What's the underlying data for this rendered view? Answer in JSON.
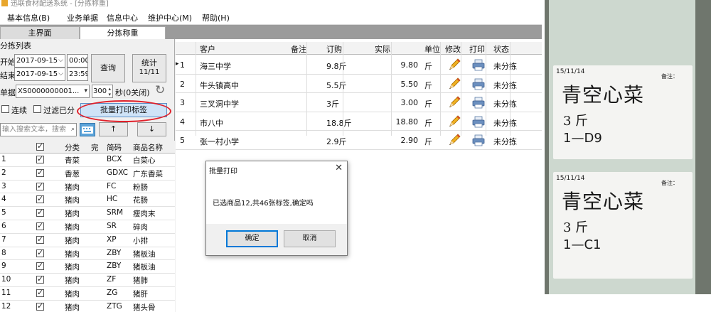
{
  "app": {
    "title": "迅联食材配送系统 - [分拣称重]",
    "menu": [
      "基本信息(B)",
      "业务单据",
      "信息中心",
      "维护中心(M)",
      "帮助(H)"
    ],
    "tabs": [
      "主界面",
      "分拣称重"
    ]
  },
  "left": {
    "section_title": "分拣列表",
    "start_label": "开始",
    "end_label": "结束",
    "start_date": "2017-09-15",
    "start_time": "00:00",
    "end_date": "2017-09-15",
    "end_time": "23:59",
    "query_button": "查询",
    "stats_button_line1": "统计",
    "stats_button_line2": "11/11",
    "doc_label": "单据",
    "doc_value": "XS0000000001...",
    "interval_value": "300",
    "interval_unit": "秒(0关闭)",
    "continuous_label": "连续",
    "filter_label": "过滤已分",
    "batch_print_button": "批量打印标签",
    "search_placeholder": "输入搜索文本，搜索",
    "up_arrow": "↑",
    "down_arrow": "↓",
    "columns": [
      "分类",
      "完",
      "简码",
      "商品名称"
    ],
    "rows": [
      {
        "num": "1",
        "category": "青菜",
        "code": "BCX",
        "name": "白菜心"
      },
      {
        "num": "2",
        "category": "香葱",
        "code": "GDXC",
        "name": "广东香菜"
      },
      {
        "num": "3",
        "category": "猪肉",
        "code": "FC",
        "name": "粉肠"
      },
      {
        "num": "4",
        "category": "猪肉",
        "code": "HC",
        "name": "花肠"
      },
      {
        "num": "5",
        "category": "猪肉",
        "code": "SRM",
        "name": "瘦肉末"
      },
      {
        "num": "6",
        "category": "猪肉",
        "code": "SR",
        "name": "碎肉"
      },
      {
        "num": "7",
        "category": "猪肉",
        "code": "XP",
        "name": "小排"
      },
      {
        "num": "8",
        "category": "猪肉",
        "code": "ZBY",
        "name": "猪板油"
      },
      {
        "num": "9",
        "category": "猪肉",
        "code": "ZBY",
        "name": "猪板油"
      },
      {
        "num": "10",
        "category": "猪肉",
        "code": "ZF",
        "name": "猪肺"
      },
      {
        "num": "11",
        "category": "猪肉",
        "code": "ZG",
        "name": "猪肝"
      },
      {
        "num": "12",
        "category": "猪肉",
        "code": "ZTG",
        "name": "猪头骨"
      }
    ]
  },
  "orders": {
    "columns": [
      "客户",
      "备注",
      "订购",
      "实际",
      "单位",
      "修改",
      "打印",
      "状态"
    ],
    "rows": [
      {
        "num": "1",
        "customer": "海三中学",
        "note": "",
        "ordered": "9.8斤",
        "actual": "9.80",
        "unit": "斤",
        "status": "未分拣"
      },
      {
        "num": "2",
        "customer": "牛头镇高中",
        "note": "",
        "ordered": "5.5斤",
        "actual": "5.50",
        "unit": "斤",
        "status": "未分拣"
      },
      {
        "num": "3",
        "customer": "三叉洞中学",
        "note": "",
        "ordered": "3斤",
        "actual": "3.00",
        "unit": "斤",
        "status": "未分拣"
      },
      {
        "num": "4",
        "customer": "市八中",
        "note": "",
        "ordered": "18.8斤",
        "actual": "18.80",
        "unit": "斤",
        "status": "未分拣"
      },
      {
        "num": "5",
        "customer": "张一村小学",
        "note": "",
        "ordered": "2.9斤",
        "actual": "2.90",
        "unit": "斤",
        "status": "未分拣"
      }
    ]
  },
  "dialog": {
    "title": "批量打印",
    "close": "✕",
    "message": "已选商品12,共46张标签,确定吗",
    "ok": "确定",
    "cancel": "取消"
  },
  "photo_labels": [
    {
      "date": "15/11/14",
      "note": "备注：",
      "name": "青空心菜",
      "qty": "3  斤",
      "code": "1—D9"
    },
    {
      "date": "15/11/14",
      "note": "备注：",
      "name": "青空心菜",
      "qty": "3  斤",
      "code": "1—C1"
    }
  ],
  "colors": {
    "highlight_oval": "#e0202a",
    "dialog_focus": "#0078d7",
    "batch_button": "#cfe3f7"
  }
}
